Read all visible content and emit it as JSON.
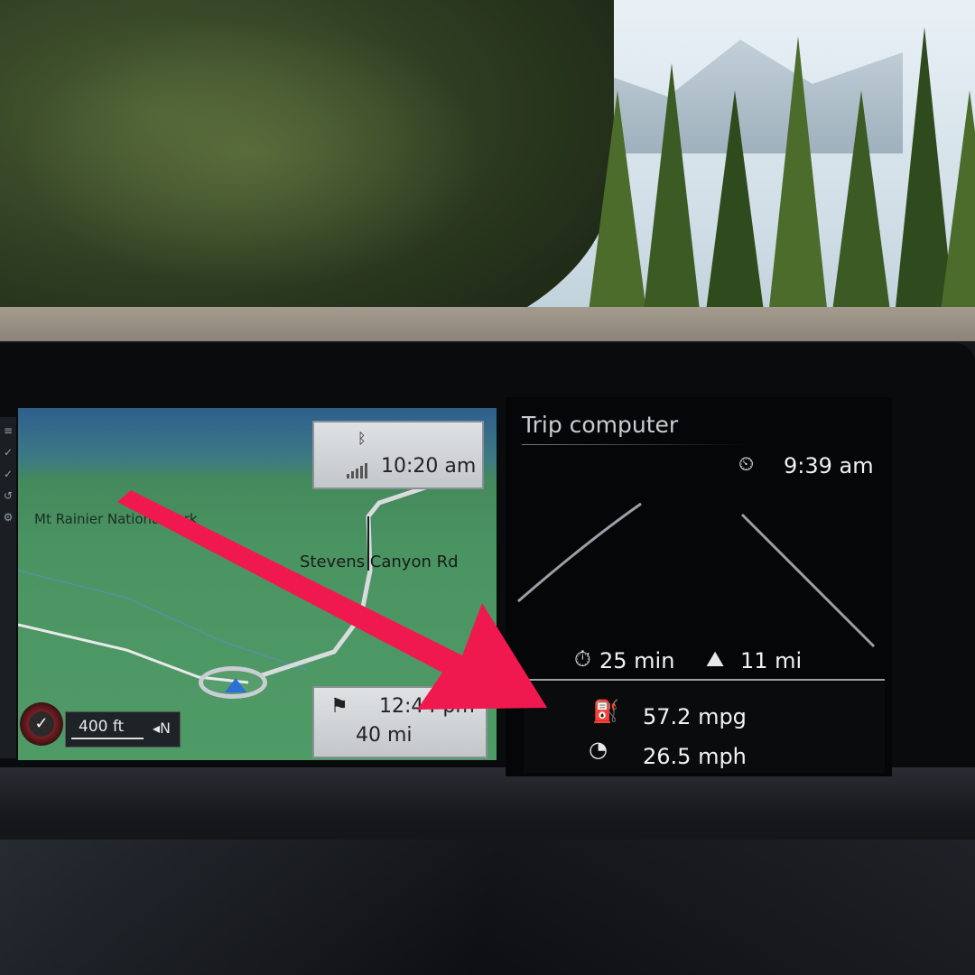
{
  "map": {
    "park_label": "Mt Rainier National Park",
    "road_label": "Stevens Canyon Rd",
    "clock_card": {
      "bluetooth_icon": "bluetooth-icon",
      "signal_icon": "signal-bars-icon",
      "time": "10:20 am"
    },
    "eta_card": {
      "flag_icon": "checkered-flag-icon",
      "arrival_time": "12:44 pm",
      "distance": "40 mi"
    },
    "scale": {
      "value": "400 ft",
      "north": "N"
    },
    "compass_glyph": "✓"
  },
  "trip_computer": {
    "title": "Trip computer",
    "start_time": "9:39 am",
    "duration": "25 min",
    "distance": "11 mi",
    "consumption": "57.2 mpg",
    "avg_speed": "26.5 mph",
    "icons": {
      "start": "clock-arrow-icon",
      "duration": "stopwatch-icon",
      "distance": "road-distance-icon",
      "consumption": "fuel-pump-icon",
      "speed": "speedometer-icon"
    }
  },
  "annotation": {
    "color": "#f0194f"
  }
}
